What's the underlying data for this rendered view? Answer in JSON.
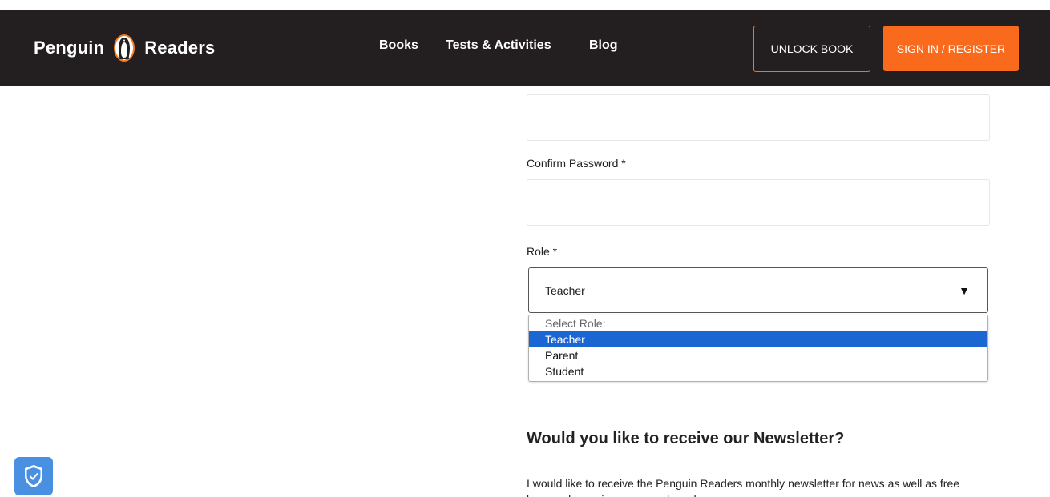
{
  "header": {
    "logo_left": "Penguin",
    "logo_right": "Readers",
    "nav": {
      "books": "Books",
      "tests": "Tests & Activities",
      "blog": "Blog"
    },
    "unlock_label": "UNLOCK BOOK",
    "signin_label": "SIGN IN / REGISTER"
  },
  "form": {
    "password_value": "",
    "confirm_label": "Confirm Password *",
    "confirm_value": "",
    "role_label": "Role *",
    "role_value": "Teacher",
    "role_options": [
      "Select Role:",
      "Teacher",
      "Parent",
      "Student"
    ]
  },
  "newsletter": {
    "title": "Would you like to receive our Newsletter?",
    "text": "I would like to receive the Penguin Readers monthly newsletter for news as well as free lesson plans, giveaways and much more."
  },
  "colors": {
    "header_bg": "#231f20",
    "accent": "#fa6a1c",
    "select_highlight": "#1a66d2",
    "shield": "#4a90e2"
  }
}
